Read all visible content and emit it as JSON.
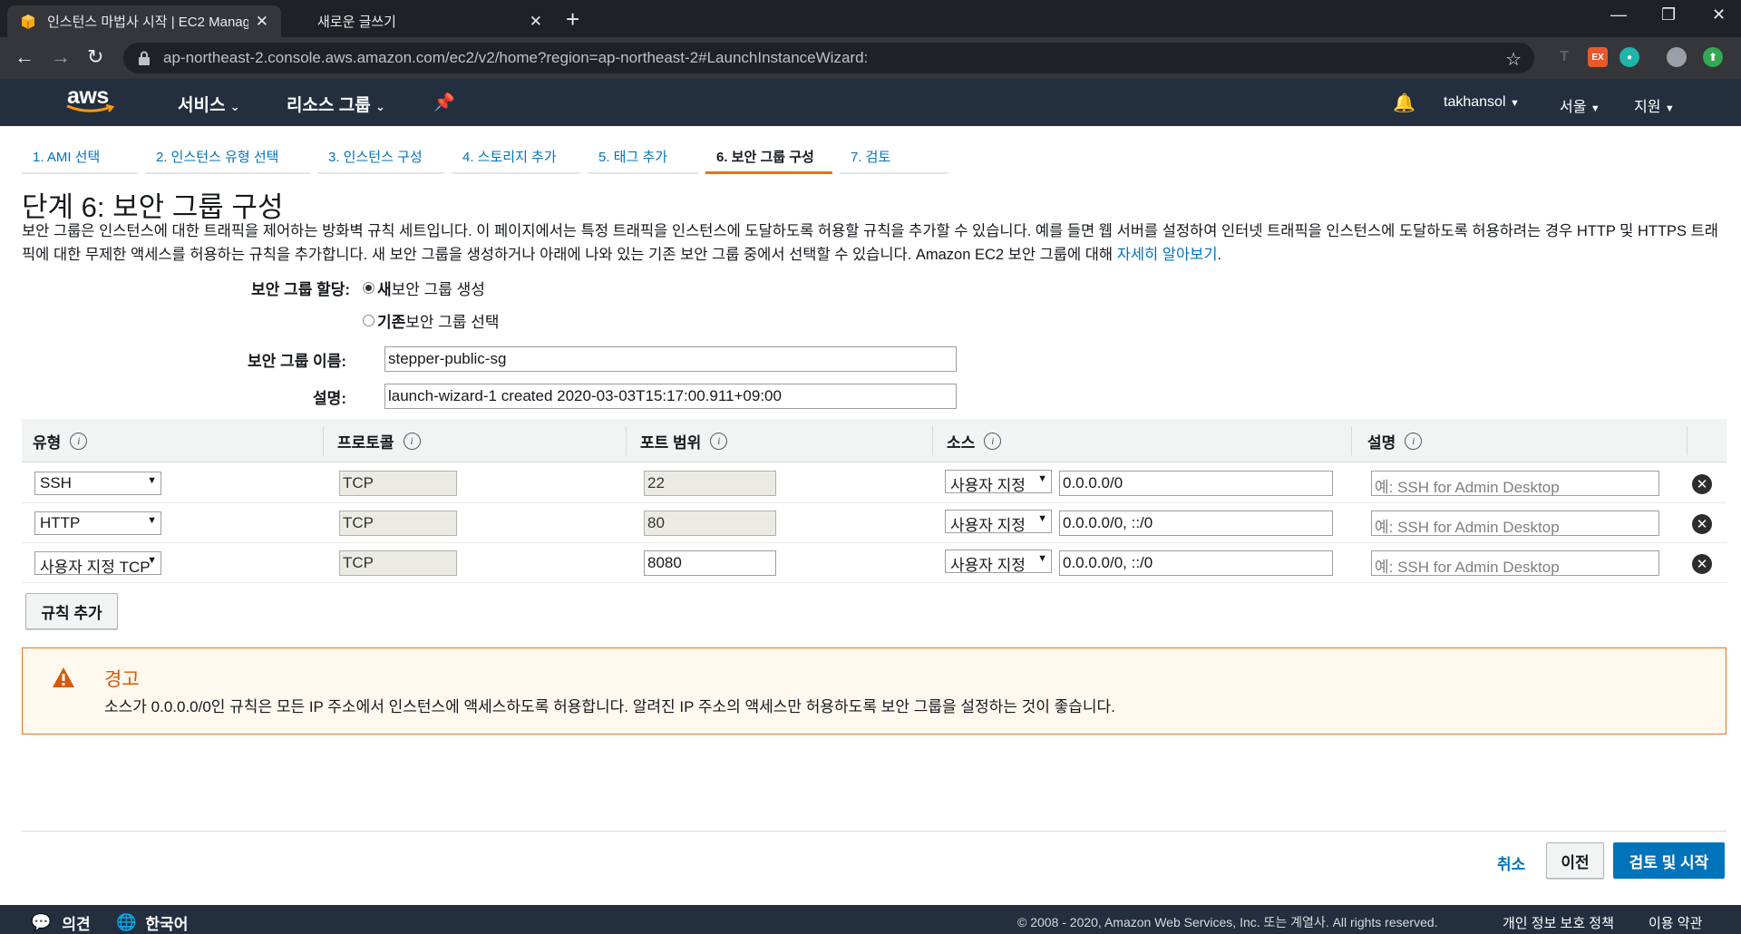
{
  "browser": {
    "tabs": [
      {
        "label": "인스턴스 마법사 시작 | EC2 Management Console",
        "active": true
      },
      {
        "label": "새로운 글쓰기",
        "active": false
      }
    ],
    "url": "ap-northeast-2.console.aws.amazon.com/ec2/v2/home?region=ap-northeast-2#LaunchInstanceWizard:",
    "ext_label": "EX"
  },
  "aws_nav": {
    "logo": "aws",
    "services": "서비스",
    "resource_groups": "리소스 그룹",
    "user": "takhansol",
    "region": "서울",
    "support": "지원"
  },
  "steps": [
    {
      "label": "1. AMI 선택",
      "active": false
    },
    {
      "label": "2. 인스턴스 유형 선택",
      "active": false
    },
    {
      "label": "3. 인스턴스 구성",
      "active": false
    },
    {
      "label": "4. 스토리지 추가",
      "active": false
    },
    {
      "label": "5. 태그 추가",
      "active": false
    },
    {
      "label": "6. 보안 그룹 구성",
      "active": true
    },
    {
      "label": "7. 검토",
      "active": false
    }
  ],
  "page": {
    "title": "단계 6: 보안 그룹 구성",
    "description": "보안 그룹은 인스턴스에 대한 트래픽을 제어하는 방화벽 규칙 세트입니다. 이 페이지에서는 특정 트래픽을 인스턴스에 도달하도록 허용할 규칙을 추가할 수 있습니다. 예를 들면 웹 서버를 설정하여 인터넷 트래픽을 인스턴스에 도달하도록 허용하려는 경우 HTTP 및 HTTPS 트래픽에 대한 무제한 액세스를 허용하는 규칙을 추가합니다. 새 보안 그룹을 생성하거나 아래에 나와 있는 기존 보안 그룹 중에서 선택할 수 있습니다. Amazon EC2 보안 그룹에 대해 ",
    "learn_more": "자세히 알아보기",
    "desc_end": "."
  },
  "form": {
    "assign_label": "보안 그룹 할당:",
    "radio_new_bold": "새",
    "radio_new_rest": " 보안 그룹 생성",
    "radio_existing_bold": "기존",
    "radio_existing_rest": " 보안 그룹 선택",
    "name_label": "보안 그룹 이름:",
    "name_value": "stepper-public-sg",
    "desc_label": "설명:",
    "desc_value": "launch-wizard-1 created 2020-03-03T15:17:00.911+09:00"
  },
  "table": {
    "headers": {
      "type": "유형",
      "protocol": "프로토콜",
      "port": "포트 범위",
      "source": "소스",
      "description": "설명"
    },
    "rows": [
      {
        "type": "SSH",
        "protocol": "TCP",
        "port": "22",
        "port_readonly": true,
        "source_type": "사용자 지정",
        "source": "0.0.0.0/0",
        "desc_placeholder": "예: SSH for Admin Desktop"
      },
      {
        "type": "HTTP",
        "protocol": "TCP",
        "port": "80",
        "port_readonly": true,
        "source_type": "사용자 지정",
        "source": "0.0.0.0/0, ::/0",
        "desc_placeholder": "예: SSH for Admin Desktop"
      },
      {
        "type": "사용자 지정 TCP",
        "protocol": "TCP",
        "port": "8080",
        "port_readonly": false,
        "source_type": "사용자 지정",
        "source": "0.0.0.0/0, ::/0",
        "desc_placeholder": "예: SSH for Admin Desktop"
      }
    ],
    "add_rule": "규칙 추가"
  },
  "warning": {
    "title": "경고",
    "text": "소스가 0.0.0.0/0인 규칙은 모든 IP 주소에서 인스턴스에 액세스하도록 허용합니다. 알려진 IP 주소의 액세스만 허용하도록 보안 그룹을 설정하는 것이 좋습니다."
  },
  "actions": {
    "cancel": "취소",
    "previous": "이전",
    "review": "검토 및 시작"
  },
  "footer": {
    "feedback": "의견",
    "language": "한국어",
    "copyright": "© 2008 - 2020, Amazon Web Services, Inc. 또는 계열사. All rights reserved.",
    "privacy": "개인 정보 보호 정책",
    "terms": "이용 약관"
  },
  "colors": {
    "aws_nav": "#232f3e",
    "accent_orange": "#ec7211",
    "link_blue": "#0073bb"
  }
}
